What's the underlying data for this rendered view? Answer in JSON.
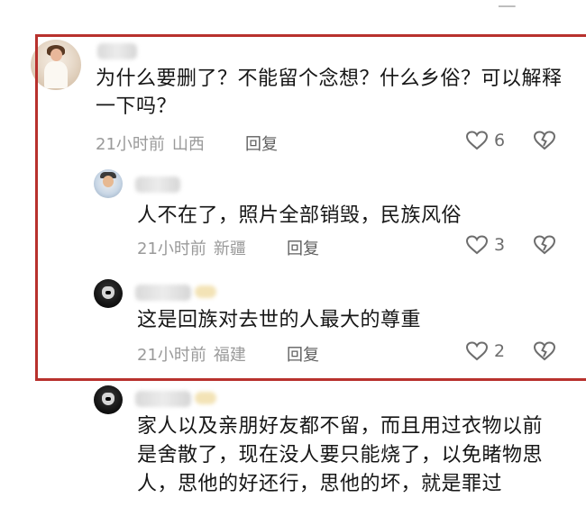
{
  "comments": [
    {
      "text": "为什么要删了？不能留个念想？什么乡俗？可以解释一下吗？",
      "time": "21小时前",
      "region": "山西",
      "reply_label": "回复",
      "likes": "6"
    },
    {
      "text": "人不在了，照片全部销毁，民族风俗",
      "time": "21小时前",
      "region": "新疆",
      "reply_label": "回复",
      "likes": "3"
    },
    {
      "text": "这是回族对去世的人最大的尊重",
      "time": "21小时前",
      "region": "福建",
      "reply_label": "回复",
      "likes": "2"
    },
    {
      "text": "家人以及亲朋好友都不留，而且用过衣物以前是舍散了，现在没人要只能烧了，以免睹物思人，思他的好还行，思他的坏，就是罪过"
    }
  ],
  "colors": {
    "highlight_border": "#b8312d",
    "meta_text": "#9a9a9a",
    "body_text": "#161616"
  },
  "icons": [
    "heart-outline-icon",
    "broken-heart-icon"
  ]
}
